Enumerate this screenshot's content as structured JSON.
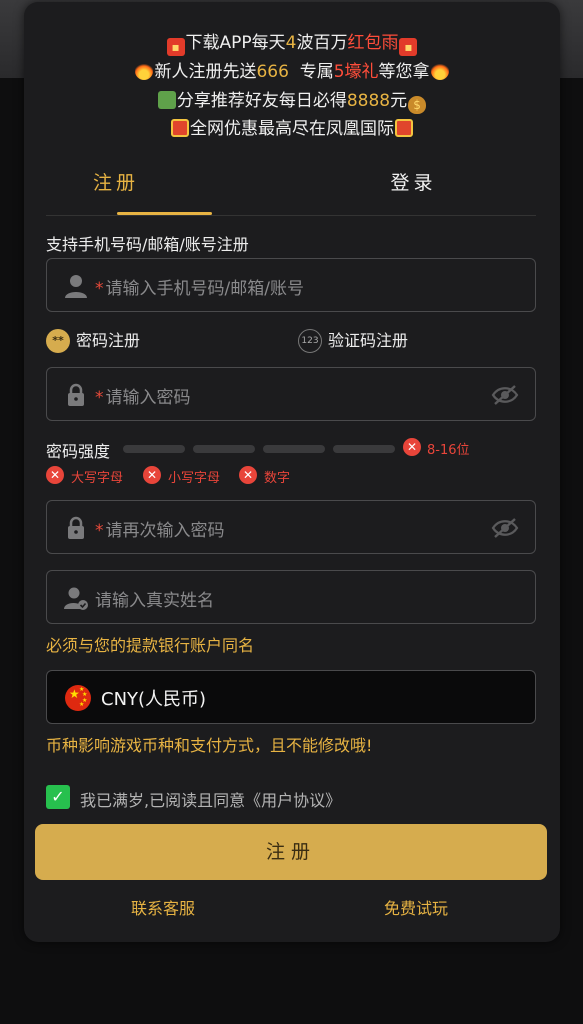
{
  "promo": {
    "line1": {
      "a": "下载APP每天",
      "b": "4",
      "c": "波百万",
      "d": "红包雨"
    },
    "line2": {
      "a": "新人注册先送",
      "b": "666",
      "c": "  专属",
      "d": "5壕礼",
      "e": "等您拿"
    },
    "line3": {
      "a": "分享推荐好友每日必得",
      "b": "8888",
      "c": "元"
    },
    "line4": {
      "a": "全网优惠最高尽在凤凰国际"
    }
  },
  "tabs": {
    "register": "注册",
    "login": "登录"
  },
  "form": {
    "support_label": "支持手机号码/邮箱/账号注册",
    "account_required": "*",
    "account_placeholder": "请输入手机号码/邮箱/账号",
    "mode_password": "密码注册",
    "mode_code": "验证码注册",
    "mode_code_icon_text": "123",
    "password_required": "*",
    "password_placeholder": "请输入密码",
    "strength_label": "密码强度",
    "length_rule": "8-16位",
    "rule_upper": "大写字母",
    "rule_lower": "小写字母",
    "rule_digit": "数字",
    "confirm_required": "*",
    "confirm_placeholder": "请再次输入密码",
    "realname_placeholder": "请输入真实姓名",
    "realname_hint": "必须与您的提款银行账户同名",
    "currency_value": "CNY(人民币)",
    "currency_hint": "币种影响游戏币种和支付方式，且不能修改哦!",
    "agree_text": "我已满岁,已阅读且同意《用户协议》",
    "submit_label": "注册"
  },
  "footer": {
    "support": "联系客服",
    "trial": "免费试玩"
  },
  "colors": {
    "accent": "#e7b343",
    "error": "#e8453a",
    "button": "#d6ac4e",
    "check": "#27c04e"
  }
}
